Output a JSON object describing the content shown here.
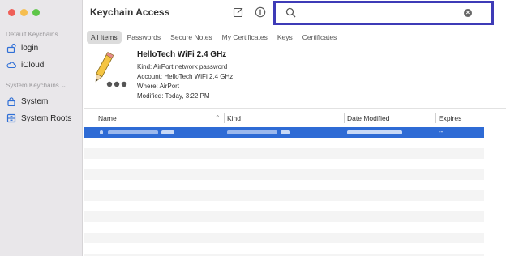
{
  "window": {
    "title": "Keychain Access"
  },
  "sidebar": {
    "default_label": "Default Keychains",
    "default_items": [
      {
        "label": "login",
        "icon": "unlock-icon"
      },
      {
        "label": "iCloud",
        "icon": "cloud-icon"
      }
    ],
    "system_label": "System Keychains",
    "system_items": [
      {
        "label": "System",
        "icon": "lock-icon"
      },
      {
        "label": "System Roots",
        "icon": "cabinet-icon"
      }
    ]
  },
  "search": {
    "value": "",
    "placeholder": ""
  },
  "tabs": [
    "All Items",
    "Passwords",
    "Secure Notes",
    "My Certificates",
    "Keys",
    "Certificates"
  ],
  "detail": {
    "title": "HelloTech WiFi 2.4 GHz",
    "kind_label": "Kind:",
    "kind_value": "AirPort network password",
    "account_label": "Account:",
    "account_value": "HelloTech WiFi 2.4 GHz",
    "where_label": "Where:",
    "where_value": "AirPort",
    "modified_label": "Modified:",
    "modified_value": "Today, 3:22 PM"
  },
  "table": {
    "columns": [
      "Name",
      "Kind",
      "Date Modified",
      "Expires"
    ],
    "selected_row": {
      "expires": "--"
    }
  },
  "colors": {
    "search_highlight": "#3e3bb7",
    "selection": "#2e6bd5",
    "sidebar_bg": "#e9e7ea"
  }
}
